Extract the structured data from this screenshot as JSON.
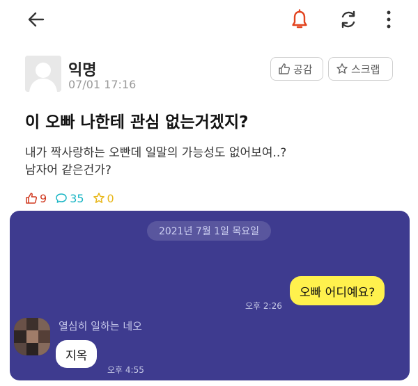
{
  "header": {
    "back_icon": "arrow-left-icon",
    "bell_icon": "bell-icon",
    "refresh_icon": "refresh-icon",
    "more_icon": "more-vertical-icon",
    "bell_color": "#e2431e"
  },
  "post": {
    "author": "익명",
    "time": "07/01 17:16",
    "like_button": "공감",
    "scrap_button": "스크랩",
    "title": "이 오빠 나한테 관심 없는거겠지?",
    "body_lines": [
      "내가 짝사랑하는 오빤데 일말의 가능성도 없어보여..?",
      "남자어 같은건가?"
    ],
    "stats": {
      "likes": "9",
      "comments": "35",
      "scraps": "0"
    }
  },
  "chat": {
    "background": "#3e3b8f",
    "date": "2021년 7월 1일 목요일",
    "outgoing": {
      "text": "오빠 어디예요?",
      "time": "오후 2:26"
    },
    "incoming": {
      "sender": "열심히 일하는 네오",
      "text": "지옥",
      "time": "오후 4:55"
    }
  }
}
